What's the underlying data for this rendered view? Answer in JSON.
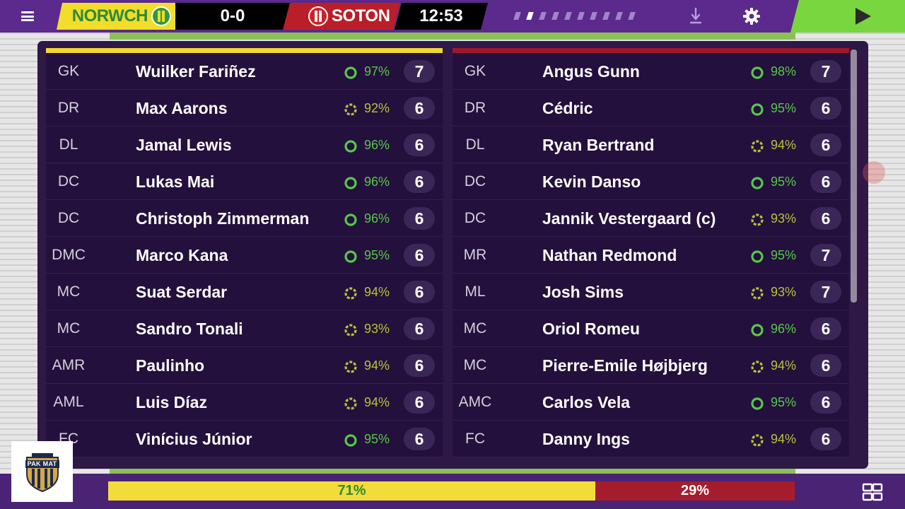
{
  "header": {
    "home_team": "NORWCH",
    "score": "0-0",
    "away_team": "SOTON",
    "clock": "12:53",
    "menu_icon": "hamburger-menu-icon",
    "speed_pips": 10,
    "active_speed_pip": 2,
    "colors": {
      "home": "#f2dd2b",
      "away": "#b91f29",
      "play": "#79d63f",
      "bar": "#5b2a8c"
    }
  },
  "home": {
    "players": [
      {
        "pos": "GK",
        "name": "Wuilker Fariñez",
        "cond": "97%",
        "cond_level": "green",
        "rating": "7"
      },
      {
        "pos": "DR",
        "name": "Max Aarons",
        "cond": "92%",
        "cond_level": "yellow",
        "rating": "6"
      },
      {
        "pos": "DL",
        "name": "Jamal Lewis",
        "cond": "96%",
        "cond_level": "green",
        "rating": "6"
      },
      {
        "pos": "DC",
        "name": "Lukas Mai",
        "cond": "96%",
        "cond_level": "green",
        "rating": "6"
      },
      {
        "pos": "DC",
        "name": "Christoph Zimmerman",
        "cond": "96%",
        "cond_level": "green",
        "rating": "6"
      },
      {
        "pos": "DMC",
        "name": "Marco Kana",
        "cond": "95%",
        "cond_level": "green",
        "rating": "6"
      },
      {
        "pos": "MC",
        "name": "Suat Serdar",
        "cond": "94%",
        "cond_level": "yellow",
        "rating": "6"
      },
      {
        "pos": "MC",
        "name": "Sandro Tonali",
        "cond": "93%",
        "cond_level": "yellow",
        "rating": "6"
      },
      {
        "pos": "AMR",
        "name": "Paulinho",
        "cond": "94%",
        "cond_level": "yellow",
        "rating": "6"
      },
      {
        "pos": "AML",
        "name": "Luis Díaz",
        "cond": "94%",
        "cond_level": "yellow",
        "rating": "6"
      },
      {
        "pos": "FC",
        "name": "Vinícius Júnior",
        "cond": "95%",
        "cond_level": "green",
        "rating": "6"
      }
    ]
  },
  "away": {
    "players": [
      {
        "pos": "GK",
        "name": "Angus Gunn",
        "cond": "98%",
        "cond_level": "green",
        "rating": "7"
      },
      {
        "pos": "DR",
        "name": "Cédric",
        "cond": "95%",
        "cond_level": "green",
        "rating": "6"
      },
      {
        "pos": "DL",
        "name": "Ryan Bertrand",
        "cond": "94%",
        "cond_level": "yellow",
        "rating": "6"
      },
      {
        "pos": "DC",
        "name": "Kevin Danso",
        "cond": "95%",
        "cond_level": "green",
        "rating": "6"
      },
      {
        "pos": "DC",
        "name": "Jannik Vestergaard (c)",
        "cond": "93%",
        "cond_level": "yellow",
        "rating": "6"
      },
      {
        "pos": "MR",
        "name": "Nathan Redmond",
        "cond": "95%",
        "cond_level": "green",
        "rating": "7"
      },
      {
        "pos": "ML",
        "name": "Josh Sims",
        "cond": "93%",
        "cond_level": "yellow",
        "rating": "7"
      },
      {
        "pos": "MC",
        "name": "Oriol Romeu",
        "cond": "96%",
        "cond_level": "green",
        "rating": "6"
      },
      {
        "pos": "MC",
        "name": "Pierre-Emile Højbjerg",
        "cond": "94%",
        "cond_level": "yellow",
        "rating": "6"
      },
      {
        "pos": "AMC",
        "name": "Carlos Vela",
        "cond": "95%",
        "cond_level": "green",
        "rating": "6"
      },
      {
        "pos": "FC",
        "name": "Danny Ings",
        "cond": "94%",
        "cond_level": "yellow",
        "rating": "6"
      }
    ]
  },
  "possession": {
    "home_label": "71%",
    "away_label": "29%",
    "home_fraction": 0.71
  },
  "watermark": {
    "text": "PAK MAT"
  },
  "colors": {
    "cond_green": "#56c84a",
    "cond_yellow": "#b7c33a"
  }
}
